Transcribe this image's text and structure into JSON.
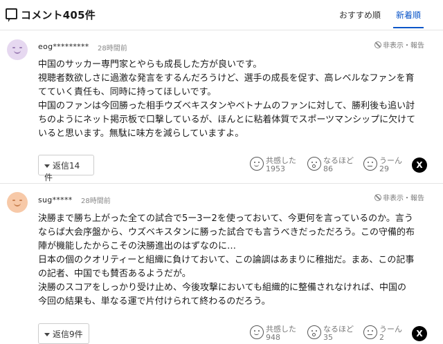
{
  "header": {
    "title": "コメント405件",
    "sort_recommended": "おすすめ順",
    "sort_newest": "新着順"
  },
  "comments": [
    {
      "user": "eog*********",
      "time": "28時間前",
      "hide_label": "非表示・報告",
      "lines": [
        "中国のサッカー専門家とやらも成長した方が良いです。",
        "視聴者数欲しさに過激な発言をするんだろうけど、選手の成長を促す、高レベルなファンを育",
        "てていく責任も、同時に持ってほしいです。",
        "中国のファンは今回勝った相手ウズベキスタンやベトナムのファンに対して、勝利後も追い討",
        "ちのようにネット掲示板で口撃しているが、ほんとに粘着体質でスポーツマンシップに欠けて",
        "いると思います。無駄に味方を減らしていますよ。"
      ],
      "reply_label": "返信14件",
      "reactions": [
        {
          "label": "共感した",
          "count": "1953",
          "icon": "smile-icon"
        },
        {
          "label": "なるほど",
          "count": "86",
          "icon": "surprised-icon"
        },
        {
          "label": "うーん",
          "count": "29",
          "icon": "meh-icon"
        }
      ],
      "share": "X"
    },
    {
      "user": "sug*****",
      "time": "28時間前",
      "hide_label": "非表示・報告",
      "lines": [
        "決勝まで勝ち上がった全ての試合で5ー3ー2を使っておいて、今更何を言っているのか。言う",
        "ならば大会序盤から、ウズベキスタンに勝った試合でも言うべきだっただろう。この守備的布",
        "陣が機能したからこその決勝進出のはずなのに…",
        "日本の個のクオリティーと組織に負けておいて、この論調はあまりに稚拙だ。まあ、この記事",
        "の記者、中国でも賛否あるようだが。",
        "決勝のスコアをしっかり受け止め、今後攻撃においても組織的に整備されなければ、中国の",
        "今回の結果も、単なる運で片付けられて終わるのだろう。"
      ],
      "reply_label": "返信9件",
      "reactions": [
        {
          "label": "共感した",
          "count": "948",
          "icon": "smile-icon"
        },
        {
          "label": "なるほど",
          "count": "35",
          "icon": "surprised-icon"
        },
        {
          "label": "うーん",
          "count": "2",
          "icon": "meh-icon"
        }
      ],
      "share": "X"
    }
  ]
}
